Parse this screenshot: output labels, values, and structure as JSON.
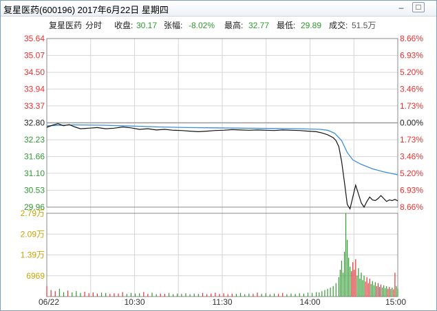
{
  "window": {
    "title": "复星医药(600196) 2017年6月22日 星期四",
    "minimize_glyph": "–",
    "maximize_glyph": "□"
  },
  "info_bar": {
    "name": "复星医药",
    "mode": "分时",
    "close_label": "收盘:",
    "close_value": "30.17",
    "change_label": "张幅:",
    "change_value": "-8.02%",
    "high_label": "最高:",
    "high_value": "32.77",
    "low_label": "最低:",
    "low_value": "29.89",
    "volume_label": "成交:",
    "volume_value": "51.5万"
  },
  "colors": {
    "up": "#e83030",
    "down": "#2e9a2e",
    "neutral": "#222222",
    "avg_line": "#3d8fd6",
    "price_line": "#111111",
    "volume_label": "#c9a300",
    "grid": "#d6d6d6"
  },
  "chart_data": {
    "type": "line",
    "prev_close": 32.8,
    "price_axis": {
      "left_ticks": [
        "35.64",
        "35.07",
        "34.50",
        "33.94",
        "33.37",
        "32.80",
        "32.23",
        "31.66",
        "31.10",
        "30.53",
        "29.96"
      ],
      "right_ticks": [
        "8.66%",
        "6.93%",
        "5.20%",
        "3.46%",
        "1.73%",
        "0.00%",
        "1.73%",
        "3.46%",
        "5.20%",
        "6.93%",
        "8.66%"
      ],
      "ylim": [
        29.96,
        35.64
      ]
    },
    "volume_axis": {
      "ticks": [
        "2.79万",
        "2.09万",
        "1.39万",
        "6969"
      ],
      "ymax": 27876
    },
    "time_axis": [
      "06/22",
      "10:30",
      "11:30",
      "14:00",
      "15:00"
    ],
    "price_series": [
      {
        "t": 0,
        "v": 32.65
      },
      {
        "t": 4,
        "v": 32.72
      },
      {
        "t": 8,
        "v": 32.77
      },
      {
        "t": 12,
        "v": 32.7
      },
      {
        "t": 16,
        "v": 32.74
      },
      {
        "t": 20,
        "v": 32.66
      },
      {
        "t": 24,
        "v": 32.6
      },
      {
        "t": 30,
        "v": 32.62
      },
      {
        "t": 36,
        "v": 32.64
      },
      {
        "t": 42,
        "v": 32.6
      },
      {
        "t": 48,
        "v": 32.62
      },
      {
        "t": 54,
        "v": 32.66
      },
      {
        "t": 60,
        "v": 32.63
      },
      {
        "t": 66,
        "v": 32.58
      },
      {
        "t": 72,
        "v": 32.6
      },
      {
        "t": 78,
        "v": 32.56
      },
      {
        "t": 84,
        "v": 32.58
      },
      {
        "t": 90,
        "v": 32.55
      },
      {
        "t": 96,
        "v": 32.54
      },
      {
        "t": 102,
        "v": 32.52
      },
      {
        "t": 108,
        "v": 32.5
      },
      {
        "t": 114,
        "v": 32.52
      },
      {
        "t": 120,
        "v": 32.54
      },
      {
        "t": 126,
        "v": 32.55
      },
      {
        "t": 132,
        "v": 32.57
      },
      {
        "t": 138,
        "v": 32.56
      },
      {
        "t": 144,
        "v": 32.55
      },
      {
        "t": 150,
        "v": 32.56
      },
      {
        "t": 156,
        "v": 32.55
      },
      {
        "t": 162,
        "v": 32.54
      },
      {
        "t": 168,
        "v": 32.56
      },
      {
        "t": 174,
        "v": 32.55
      },
      {
        "t": 180,
        "v": 32.54
      },
      {
        "t": 186,
        "v": 32.52
      },
      {
        "t": 192,
        "v": 32.5
      },
      {
        "t": 196,
        "v": 32.46
      },
      {
        "t": 200,
        "v": 32.4
      },
      {
        "t": 204,
        "v": 32.3
      },
      {
        "t": 206,
        "v": 32.2
      },
      {
        "t": 208,
        "v": 32.0
      },
      {
        "t": 210,
        "v": 31.5
      },
      {
        "t": 212,
        "v": 30.8
      },
      {
        "t": 214,
        "v": 30.05
      },
      {
        "t": 216,
        "v": 29.9
      },
      {
        "t": 218,
        "v": 30.3
      },
      {
        "t": 220,
        "v": 30.7
      },
      {
        "t": 222,
        "v": 30.4
      },
      {
        "t": 224,
        "v": 30.1
      },
      {
        "t": 226,
        "v": 29.96
      },
      {
        "t": 228,
        "v": 30.15
      },
      {
        "t": 230,
        "v": 30.3
      },
      {
        "t": 232,
        "v": 30.2
      },
      {
        "t": 234,
        "v": 30.18
      },
      {
        "t": 236,
        "v": 30.25
      },
      {
        "t": 238,
        "v": 30.35
      },
      {
        "t": 240,
        "v": 30.25
      },
      {
        "t": 242,
        "v": 30.15
      },
      {
        "t": 244,
        "v": 30.2
      },
      {
        "t": 246,
        "v": 30.18
      },
      {
        "t": 248,
        "v": 30.22
      },
      {
        "t": 250,
        "v": 30.17
      }
    ],
    "avg_series": [
      {
        "t": 0,
        "v": 32.7
      },
      {
        "t": 20,
        "v": 32.73
      },
      {
        "t": 40,
        "v": 32.72
      },
      {
        "t": 60,
        "v": 32.69
      },
      {
        "t": 80,
        "v": 32.66
      },
      {
        "t": 100,
        "v": 32.64
      },
      {
        "t": 120,
        "v": 32.63
      },
      {
        "t": 140,
        "v": 32.62
      },
      {
        "t": 160,
        "v": 32.61
      },
      {
        "t": 180,
        "v": 32.6
      },
      {
        "t": 195,
        "v": 32.58
      },
      {
        "t": 200,
        "v": 32.55
      },
      {
        "t": 205,
        "v": 32.45
      },
      {
        "t": 210,
        "v": 32.2
      },
      {
        "t": 214,
        "v": 31.8
      },
      {
        "t": 218,
        "v": 31.55
      },
      {
        "t": 224,
        "v": 31.4
      },
      {
        "t": 232,
        "v": 31.25
      },
      {
        "t": 240,
        "v": 31.15
      },
      {
        "t": 250,
        "v": 31.05
      }
    ],
    "volume": [
      {
        "t": 0,
        "v": 3500
      },
      {
        "t": 3,
        "v": 2200
      },
      {
        "t": 6,
        "v": 1800
      },
      {
        "t": 9,
        "v": 2600
      },
      {
        "t": 12,
        "v": 1500
      },
      {
        "t": 15,
        "v": 2000
      },
      {
        "t": 18,
        "v": 1400
      },
      {
        "t": 21,
        "v": 1800
      },
      {
        "t": 24,
        "v": 1200
      },
      {
        "t": 27,
        "v": 1600
      },
      {
        "t": 30,
        "v": 1100
      },
      {
        "t": 33,
        "v": 1400
      },
      {
        "t": 36,
        "v": 1000
      },
      {
        "t": 39,
        "v": 1300
      },
      {
        "t": 42,
        "v": 1200
      },
      {
        "t": 45,
        "v": 900
      },
      {
        "t": 48,
        "v": 1100
      },
      {
        "t": 51,
        "v": 1000
      },
      {
        "t": 54,
        "v": 1500
      },
      {
        "t": 57,
        "v": 900
      },
      {
        "t": 60,
        "v": 1200
      },
      {
        "t": 63,
        "v": 1000
      },
      {
        "t": 66,
        "v": 1100
      },
      {
        "t": 69,
        "v": 1500
      },
      {
        "t": 72,
        "v": 900
      },
      {
        "t": 75,
        "v": 1300
      },
      {
        "t": 78,
        "v": 800
      },
      {
        "t": 81,
        "v": 1000
      },
      {
        "t": 84,
        "v": 900
      },
      {
        "t": 87,
        "v": 1200
      },
      {
        "t": 90,
        "v": 800
      },
      {
        "t": 93,
        "v": 1000
      },
      {
        "t": 96,
        "v": 900
      },
      {
        "t": 99,
        "v": 1100
      },
      {
        "t": 102,
        "v": 800
      },
      {
        "t": 105,
        "v": 1000
      },
      {
        "t": 108,
        "v": 900
      },
      {
        "t": 111,
        "v": 1200
      },
      {
        "t": 114,
        "v": 800
      },
      {
        "t": 117,
        "v": 1000
      },
      {
        "t": 120,
        "v": 1300
      },
      {
        "t": 123,
        "v": 900
      },
      {
        "t": 126,
        "v": 1100
      },
      {
        "t": 129,
        "v": 800
      },
      {
        "t": 132,
        "v": 1000
      },
      {
        "t": 135,
        "v": 900
      },
      {
        "t": 138,
        "v": 1200
      },
      {
        "t": 141,
        "v": 800
      },
      {
        "t": 144,
        "v": 1000
      },
      {
        "t": 147,
        "v": 900
      },
      {
        "t": 150,
        "v": 1300
      },
      {
        "t": 153,
        "v": 900
      },
      {
        "t": 156,
        "v": 1100
      },
      {
        "t": 159,
        "v": 800
      },
      {
        "t": 162,
        "v": 1000
      },
      {
        "t": 165,
        "v": 900
      },
      {
        "t": 168,
        "v": 1200
      },
      {
        "t": 171,
        "v": 800
      },
      {
        "t": 174,
        "v": 1000
      },
      {
        "t": 177,
        "v": 900
      },
      {
        "t": 180,
        "v": 1100
      },
      {
        "t": 183,
        "v": 1000
      },
      {
        "t": 186,
        "v": 1300
      },
      {
        "t": 189,
        "v": 1200
      },
      {
        "t": 192,
        "v": 1500
      },
      {
        "t": 194,
        "v": 1400
      },
      {
        "t": 196,
        "v": 1800
      },
      {
        "t": 198,
        "v": 2200
      },
      {
        "t": 200,
        "v": 2600
      },
      {
        "t": 202,
        "v": 3000
      },
      {
        "t": 204,
        "v": 3500
      },
      {
        "t": 206,
        "v": 4500
      },
      {
        "t": 208,
        "v": 6500
      },
      {
        "t": 209,
        "v": 9000
      },
      {
        "t": 210,
        "v": 12000
      },
      {
        "t": 211,
        "v": 8000
      },
      {
        "t": 212,
        "v": 15000
      },
      {
        "t": 213,
        "v": 27876
      },
      {
        "t": 214,
        "v": 19000
      },
      {
        "t": 215,
        "v": 13000
      },
      {
        "t": 216,
        "v": 10000
      },
      {
        "t": 217,
        "v": 8500
      },
      {
        "t": 218,
        "v": 11500
      },
      {
        "t": 219,
        "v": 9000
      },
      {
        "t": 220,
        "v": 12500
      },
      {
        "t": 221,
        "v": 7000
      },
      {
        "t": 222,
        "v": 9500
      },
      {
        "t": 223,
        "v": 6000
      },
      {
        "t": 224,
        "v": 8000
      },
      {
        "t": 225,
        "v": 5500
      },
      {
        "t": 226,
        "v": 7000
      },
      {
        "t": 227,
        "v": 5000
      },
      {
        "t": 228,
        "v": 6500
      },
      {
        "t": 229,
        "v": 4500
      },
      {
        "t": 230,
        "v": 6000
      },
      {
        "t": 231,
        "v": 4200
      },
      {
        "t": 232,
        "v": 5200
      },
      {
        "t": 233,
        "v": 3800
      },
      {
        "t": 234,
        "v": 4800
      },
      {
        "t": 235,
        "v": 3500
      },
      {
        "t": 236,
        "v": 4500
      },
      {
        "t": 237,
        "v": 3200
      },
      {
        "t": 238,
        "v": 4000
      },
      {
        "t": 239,
        "v": 3000
      },
      {
        "t": 240,
        "v": 3800
      },
      {
        "t": 241,
        "v": 2800
      },
      {
        "t": 242,
        "v": 3500
      },
      {
        "t": 243,
        "v": 2600
      },
      {
        "t": 244,
        "v": 3200
      },
      {
        "t": 245,
        "v": 2500
      },
      {
        "t": 246,
        "v": 3000
      },
      {
        "t": 247,
        "v": 2400
      },
      {
        "t": 248,
        "v": 8000
      },
      {
        "t": 249,
        "v": 3500
      },
      {
        "t": 250,
        "v": 2600
      }
    ]
  }
}
